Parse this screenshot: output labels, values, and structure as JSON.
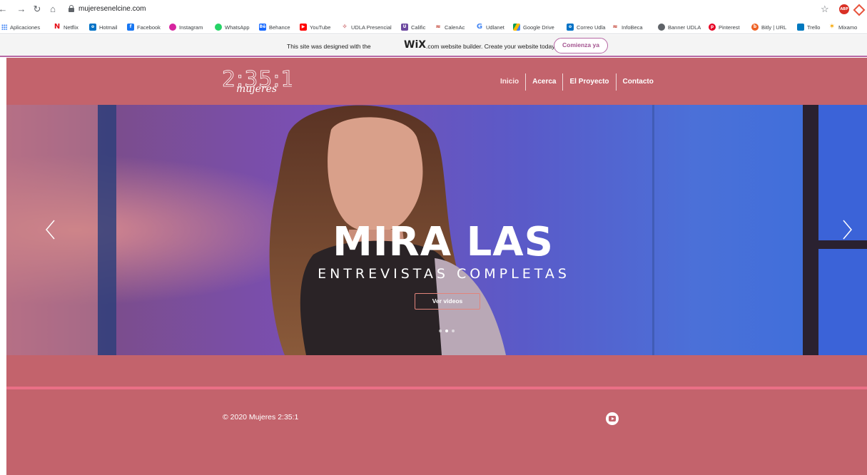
{
  "browser": {
    "url": "mujeresenelcine.com",
    "bookmarks": [
      {
        "label": "Aplicaciones",
        "icon": "apps-grid-icon"
      },
      {
        "label": "Netflix",
        "icon": "netflix-icon",
        "color": "#e50914"
      },
      {
        "label": "Hotmail",
        "icon": "outlook-icon",
        "color": "#0072c6"
      },
      {
        "label": "Facebook",
        "icon": "facebook-icon",
        "color": "#1877f2"
      },
      {
        "label": "Instagram",
        "icon": "instagram-icon",
        "color": "#d6249f"
      },
      {
        "label": "WhatsApp",
        "icon": "whatsapp-icon",
        "color": "#25d366"
      },
      {
        "label": "Behance",
        "icon": "behance-icon",
        "color": "#1769ff"
      },
      {
        "label": "YouTube",
        "icon": "youtube-icon",
        "color": "#ff0000"
      },
      {
        "label": "UDLA Presencial",
        "icon": "udla-icon",
        "color": "#b11b21"
      },
      {
        "label": "Calific",
        "icon": "calific-icon",
        "color": "#6d4aa0"
      },
      {
        "label": "CalenAc",
        "icon": "udla-calendar-icon",
        "color": "#c0392b"
      },
      {
        "label": "Udlanet",
        "icon": "google-icon",
        "color": "#4285f4"
      },
      {
        "label": "Google Drive",
        "icon": "google-drive-icon",
        "color": "#fbbc04"
      },
      {
        "label": "Correo Udla",
        "icon": "outlook-icon",
        "color": "#0072c6"
      },
      {
        "label": "InfoBeca",
        "icon": "udla-icon",
        "color": "#c0392b"
      },
      {
        "label": "Banner UDLA",
        "icon": "globe-icon",
        "color": "#5f6368"
      },
      {
        "label": "Pinterest",
        "icon": "pinterest-icon",
        "color": "#e60023"
      },
      {
        "label": "Bitly | URL",
        "icon": "bitly-icon",
        "color": "#ee6123"
      },
      {
        "label": "Trello",
        "icon": "trello-icon",
        "color": "#0079bf"
      },
      {
        "label": "Mixamo",
        "icon": "mixamo-icon",
        "color": "#f7a600"
      }
    ]
  },
  "wix_banner": {
    "text_before": "This site was designed with the",
    "logo": "WiX",
    "text_after": ".com website builder. Create your website today.",
    "button": "Comienza ya"
  },
  "site": {
    "brand_color": "#c3636c",
    "accent_color": "#ea6f86",
    "logo_text": "2:35:1",
    "logo_script": "mujeres",
    "menu": [
      "Inicio",
      "Acerca",
      "El Proyecto",
      "Contacto"
    ],
    "slide": {
      "title": "MIRA LAS",
      "subtitle": "ENTREVISTAS COMPLETAS",
      "button": "Ver videos",
      "slide_count": 3,
      "active_slide": 2
    },
    "footer": {
      "copyright": "© 2020 Mujeres 2:35:1",
      "social_icon": "youtube-icon"
    }
  }
}
